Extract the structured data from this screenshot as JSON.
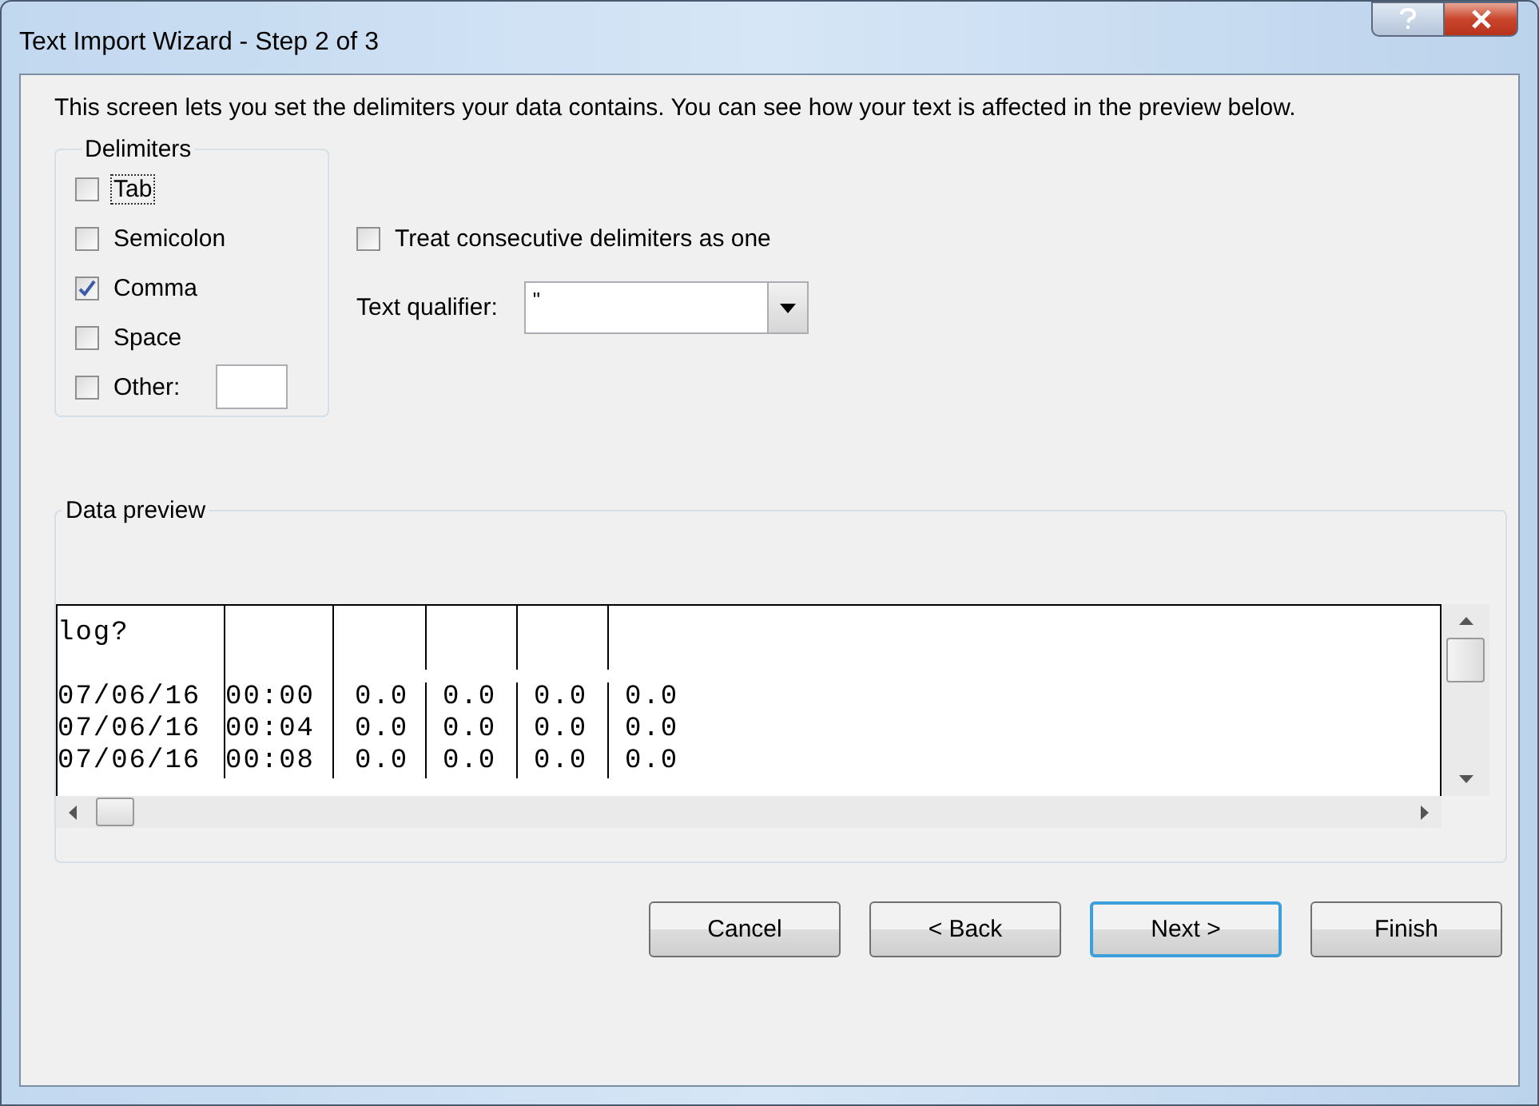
{
  "window": {
    "title": "Text Import Wizard - Step 2 of 3"
  },
  "description": "This screen lets you set the delimiters your data contains.  You can see how your text is affected in the preview below.",
  "delimiters": {
    "label": "Delimiters",
    "options": [
      {
        "label": "Tab",
        "checked": false,
        "focused": true,
        "kind": "plain"
      },
      {
        "label": "Semicolon",
        "checked": false,
        "focused": false,
        "kind": "plain"
      },
      {
        "label": "Comma",
        "checked": true,
        "focused": false,
        "kind": "plain"
      },
      {
        "label": "Space",
        "checked": false,
        "focused": false,
        "kind": "plain"
      },
      {
        "label": "Other:",
        "checked": false,
        "focused": false,
        "kind": "with_field"
      }
    ]
  },
  "treat_consecutive": {
    "label": "Treat consecutive delimiters as one",
    "checked": false
  },
  "text_qualifier": {
    "label": "Text qualifier:",
    "value": "\""
  },
  "data_preview": {
    "label": "Data preview",
    "rows": [
      {
        "cells": [
          "log?"
        ],
        "gap_after": true
      },
      {
        "cells": [
          "07/06/16",
          "00:00",
          "0.0",
          "0.0",
          "0.0",
          "0.0"
        ],
        "gap_after": false
      },
      {
        "cells": [
          "07/06/16",
          "00:04",
          "0.0",
          "0.0",
          "0.0",
          "0.0"
        ],
        "gap_after": false
      },
      {
        "cells": [
          "07/06/16",
          "00:08",
          "0.0",
          "0.0",
          "0.0",
          "0.0"
        ],
        "gap_after": false
      }
    ]
  },
  "buttons": [
    {
      "label": "Cancel",
      "default": false
    },
    {
      "label": "< Back",
      "default": false
    },
    {
      "label": "Next >",
      "default": true
    },
    {
      "label": "Finish",
      "default": false
    }
  ]
}
